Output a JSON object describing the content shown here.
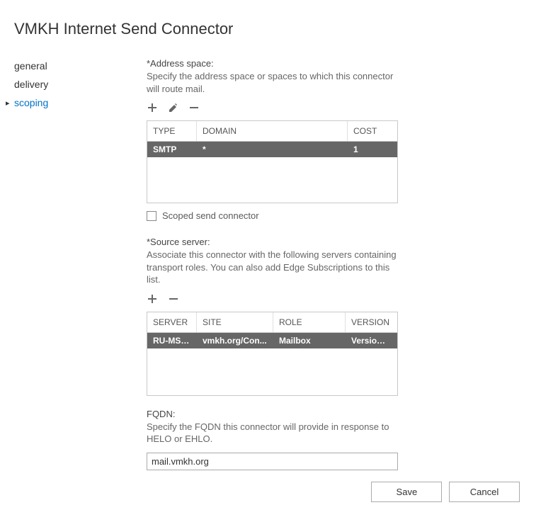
{
  "title": "VMKH Internet Send Connector",
  "sidebar": {
    "items": [
      {
        "label": "general"
      },
      {
        "label": "delivery"
      },
      {
        "label": "scoping",
        "active": true
      }
    ]
  },
  "addressSpace": {
    "label": "*Address space:",
    "desc": "Specify the address space or spaces to which this connector will route mail.",
    "headers": {
      "type": "TYPE",
      "domain": "DOMAIN",
      "cost": "COST"
    },
    "row": {
      "type": "SMTP",
      "domain": "*",
      "cost": "1"
    }
  },
  "scopedCheckbox": {
    "label": "Scoped send connector"
  },
  "sourceServer": {
    "label": "*Source server:",
    "desc": "Associate this connector with the following servers containing transport roles. You can also add Edge Subscriptions to this list.",
    "headers": {
      "server": "SERVER",
      "site": "SITE",
      "role": "ROLE",
      "version": "VERSION"
    },
    "row": {
      "server": "RU-MSK...",
      "site": "vmkh.org/Con...",
      "role": "Mailbox",
      "version": "Version ..."
    }
  },
  "fqdn": {
    "label": "FQDN:",
    "desc": "Specify the FQDN this connector will provide in response to HELO or EHLO.",
    "value": "mail.vmkh.org"
  },
  "buttons": {
    "save": "Save",
    "cancel": "Cancel"
  }
}
